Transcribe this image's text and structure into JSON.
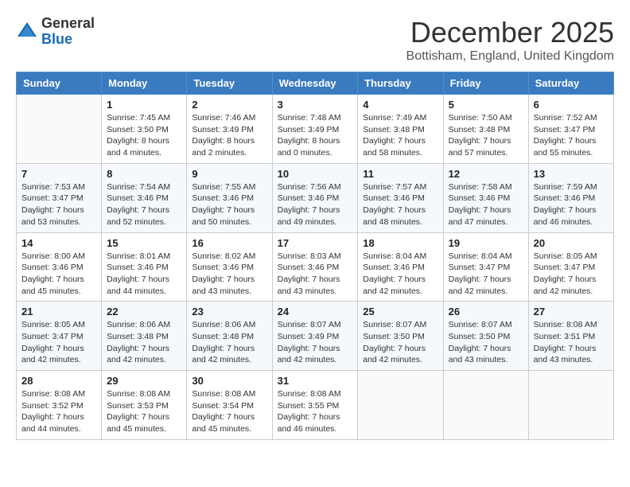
{
  "logo": {
    "general": "General",
    "blue": "Blue"
  },
  "title": "December 2025",
  "subtitle": "Bottisham, England, United Kingdom",
  "days_of_week": [
    "Sunday",
    "Monday",
    "Tuesday",
    "Wednesday",
    "Thursday",
    "Friday",
    "Saturday"
  ],
  "weeks": [
    [
      {
        "day": "",
        "info": ""
      },
      {
        "day": "1",
        "info": "Sunrise: 7:45 AM\nSunset: 3:50 PM\nDaylight: 8 hours\nand 4 minutes."
      },
      {
        "day": "2",
        "info": "Sunrise: 7:46 AM\nSunset: 3:49 PM\nDaylight: 8 hours\nand 2 minutes."
      },
      {
        "day": "3",
        "info": "Sunrise: 7:48 AM\nSunset: 3:49 PM\nDaylight: 8 hours\nand 0 minutes."
      },
      {
        "day": "4",
        "info": "Sunrise: 7:49 AM\nSunset: 3:48 PM\nDaylight: 7 hours\nand 58 minutes."
      },
      {
        "day": "5",
        "info": "Sunrise: 7:50 AM\nSunset: 3:48 PM\nDaylight: 7 hours\nand 57 minutes."
      },
      {
        "day": "6",
        "info": "Sunrise: 7:52 AM\nSunset: 3:47 PM\nDaylight: 7 hours\nand 55 minutes."
      }
    ],
    [
      {
        "day": "7",
        "info": "Sunrise: 7:53 AM\nSunset: 3:47 PM\nDaylight: 7 hours\nand 53 minutes."
      },
      {
        "day": "8",
        "info": "Sunrise: 7:54 AM\nSunset: 3:46 PM\nDaylight: 7 hours\nand 52 minutes."
      },
      {
        "day": "9",
        "info": "Sunrise: 7:55 AM\nSunset: 3:46 PM\nDaylight: 7 hours\nand 50 minutes."
      },
      {
        "day": "10",
        "info": "Sunrise: 7:56 AM\nSunset: 3:46 PM\nDaylight: 7 hours\nand 49 minutes."
      },
      {
        "day": "11",
        "info": "Sunrise: 7:57 AM\nSunset: 3:46 PM\nDaylight: 7 hours\nand 48 minutes."
      },
      {
        "day": "12",
        "info": "Sunrise: 7:58 AM\nSunset: 3:46 PM\nDaylight: 7 hours\nand 47 minutes."
      },
      {
        "day": "13",
        "info": "Sunrise: 7:59 AM\nSunset: 3:46 PM\nDaylight: 7 hours\nand 46 minutes."
      }
    ],
    [
      {
        "day": "14",
        "info": "Sunrise: 8:00 AM\nSunset: 3:46 PM\nDaylight: 7 hours\nand 45 minutes."
      },
      {
        "day": "15",
        "info": "Sunrise: 8:01 AM\nSunset: 3:46 PM\nDaylight: 7 hours\nand 44 minutes."
      },
      {
        "day": "16",
        "info": "Sunrise: 8:02 AM\nSunset: 3:46 PM\nDaylight: 7 hours\nand 43 minutes."
      },
      {
        "day": "17",
        "info": "Sunrise: 8:03 AM\nSunset: 3:46 PM\nDaylight: 7 hours\nand 43 minutes."
      },
      {
        "day": "18",
        "info": "Sunrise: 8:04 AM\nSunset: 3:46 PM\nDaylight: 7 hours\nand 42 minutes."
      },
      {
        "day": "19",
        "info": "Sunrise: 8:04 AM\nSunset: 3:47 PM\nDaylight: 7 hours\nand 42 minutes."
      },
      {
        "day": "20",
        "info": "Sunrise: 8:05 AM\nSunset: 3:47 PM\nDaylight: 7 hours\nand 42 minutes."
      }
    ],
    [
      {
        "day": "21",
        "info": "Sunrise: 8:05 AM\nSunset: 3:47 PM\nDaylight: 7 hours\nand 42 minutes."
      },
      {
        "day": "22",
        "info": "Sunrise: 8:06 AM\nSunset: 3:48 PM\nDaylight: 7 hours\nand 42 minutes."
      },
      {
        "day": "23",
        "info": "Sunrise: 8:06 AM\nSunset: 3:48 PM\nDaylight: 7 hours\nand 42 minutes."
      },
      {
        "day": "24",
        "info": "Sunrise: 8:07 AM\nSunset: 3:49 PM\nDaylight: 7 hours\nand 42 minutes."
      },
      {
        "day": "25",
        "info": "Sunrise: 8:07 AM\nSunset: 3:50 PM\nDaylight: 7 hours\nand 42 minutes."
      },
      {
        "day": "26",
        "info": "Sunrise: 8:07 AM\nSunset: 3:50 PM\nDaylight: 7 hours\nand 43 minutes."
      },
      {
        "day": "27",
        "info": "Sunrise: 8:08 AM\nSunset: 3:51 PM\nDaylight: 7 hours\nand 43 minutes."
      }
    ],
    [
      {
        "day": "28",
        "info": "Sunrise: 8:08 AM\nSunset: 3:52 PM\nDaylight: 7 hours\nand 44 minutes."
      },
      {
        "day": "29",
        "info": "Sunrise: 8:08 AM\nSunset: 3:53 PM\nDaylight: 7 hours\nand 45 minutes."
      },
      {
        "day": "30",
        "info": "Sunrise: 8:08 AM\nSunset: 3:54 PM\nDaylight: 7 hours\nand 45 minutes."
      },
      {
        "day": "31",
        "info": "Sunrise: 8:08 AM\nSunset: 3:55 PM\nDaylight: 7 hours\nand 46 minutes."
      },
      {
        "day": "",
        "info": ""
      },
      {
        "day": "",
        "info": ""
      },
      {
        "day": "",
        "info": ""
      }
    ]
  ]
}
